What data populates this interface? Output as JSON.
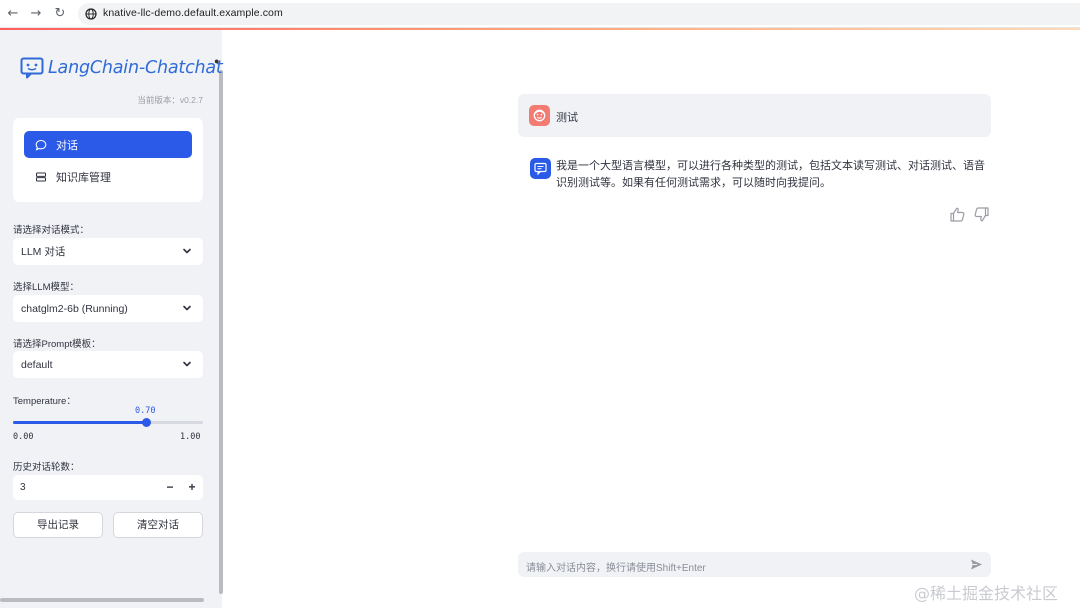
{
  "browser": {
    "url": "knative-llc-demo.default.example.com"
  },
  "sidebar": {
    "logo_text": "LangChain-Chatchat",
    "version": "当前版本：v0.2.7",
    "menu": [
      {
        "label": "对话",
        "active": true
      },
      {
        "label": "知识库管理",
        "active": false
      }
    ],
    "mode": {
      "label": "请选择对话模式：",
      "value": "LLM 对话"
    },
    "model": {
      "label": "选择LLM模型：",
      "value": "chatglm2-6b (Running)"
    },
    "prompt": {
      "label": "请选择Prompt模板：",
      "value": "default"
    },
    "temperature": {
      "label": "Temperature：",
      "value": "0.70",
      "value_num": 0.7,
      "min": "0.00",
      "max": "1.00"
    },
    "history": {
      "label": "历史对话轮数：",
      "value": "3",
      "minus": "−",
      "plus": "+"
    },
    "buttons": {
      "export": "导出记录",
      "clear": "清空对话"
    }
  },
  "chat": {
    "messages": [
      {
        "role": "user",
        "text": "测试"
      },
      {
        "role": "assistant",
        "text": "我是一个大型语言模型，可以进行各种类型的测试，包括文本读写测试、对话测试、语音识别测试等。如果有任何测试需求，可以随时向我提问。"
      }
    ],
    "input_placeholder": "请输入对话内容，换行请使用Shift+Enter"
  },
  "watermark": "@稀土掘金技术社区",
  "colors": {
    "accent": "#2b59e8",
    "user_avatar": "#f27b72",
    "sidebar_bg": "#f0f2f6"
  }
}
